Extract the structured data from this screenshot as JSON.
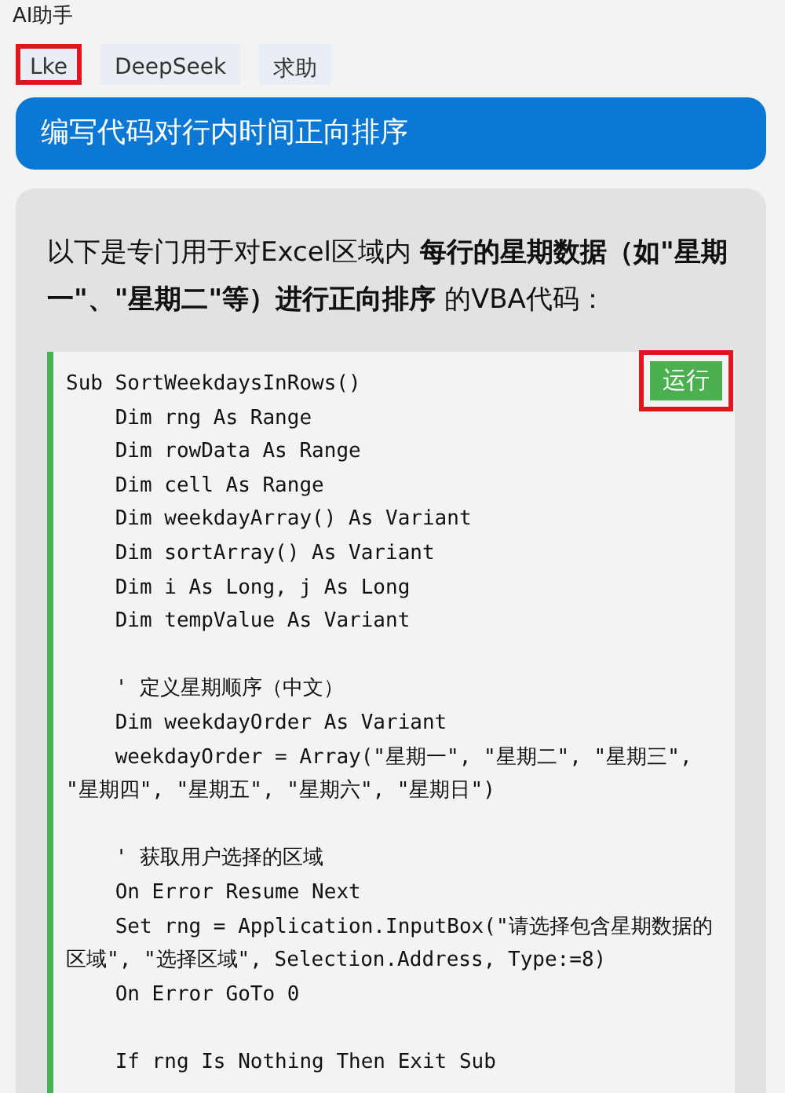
{
  "window": {
    "title": "AI助手"
  },
  "tabs": [
    {
      "label": "Lke",
      "highlighted": true
    },
    {
      "label": "DeepSeek",
      "highlighted": false
    },
    {
      "label": "求助",
      "highlighted": false
    }
  ],
  "prompt": "编写代码对行内时间正向排序",
  "answer": {
    "intro": "以下是专门用于对Excel区域内 **每行的星期数据（如\"星期一\"、\"星期二\"等）进行正向排序** 的VBA代码：",
    "code": {
      "run_button": {
        "label": "运行",
        "highlighted": true
      },
      "blocks": [
        [
          "Sub SortWeekdaysInRows()",
          "    Dim rng As Range",
          "    Dim rowData As Range",
          "    Dim cell As Range",
          "    Dim weekdayArray() As Variant",
          "    Dim sortArray() As Variant",
          "    Dim i As Long, j As Long",
          "    Dim tempValue As Variant"
        ],
        [
          "    ' 定义星期顺序（中文）",
          "    Dim weekdayOrder As Variant",
          "    weekdayOrder = Array(\"星期一\", \"星期二\", \"星期三\", \"星期四\", \"星期五\", \"星期六\", \"星期日\")"
        ],
        [
          "    ' 获取用户选择的区域",
          "    On Error Resume Next",
          "    Set rng = Application.InputBox(\"请选择包含星期数据的区域\", \"选择区域\", Selection.Address, Type:=8)",
          "    On Error GoTo 0"
        ],
        [
          "    If rng Is Nothing Then Exit Sub"
        ]
      ]
    }
  }
}
